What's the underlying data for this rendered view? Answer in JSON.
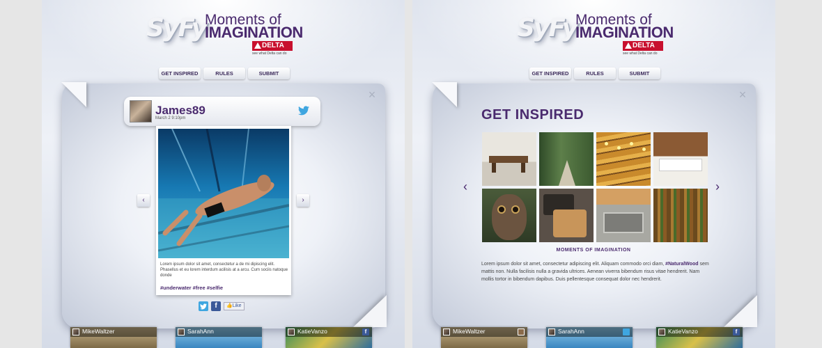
{
  "brand": {
    "logo": "SyFy",
    "title_line1": "Moments of",
    "title_line2": "IMAGINATION",
    "sponsor": "DELTA",
    "sponsor_tagline": "see what Delta can do"
  },
  "nav": [
    "GET INSPIRED",
    "RULES",
    "SUBMIT"
  ],
  "close_glyph": "×",
  "left_panel": {
    "user": "James89",
    "date": "March 2 9:10pm",
    "post_text": "Lorem ipsum dolor sit amet, consectetur a de mi dipiscing elit. Phasellus et eu lorem interdum acilisis at a arcu. Cum sociis natoque donde",
    "hashtags": "#underwater #free #selfie",
    "prev": "‹",
    "next": "›",
    "like_label": "Like",
    "fb_glyph": "f"
  },
  "thumbnails_left": [
    {
      "name": "MikeWaltzer",
      "network": "instagram"
    },
    {
      "name": "SarahAnn",
      "network": "instagram"
    },
    {
      "name": "KatieVanzo",
      "network": "facebook"
    }
  ],
  "right_panel": {
    "title": "GET INSPIRED",
    "caption": "MOMENTS OF IMAGINATION",
    "desc_before": "Lorem ipsum dolor sit amet, consectetur adipiscing elit. Aliquam commodo orci diam",
    "desc_hashtag": "#NaturalWood",
    "desc_after": " sem mattis non. Nulla facilisis nulla a gravida ultrices. Aenean viverra bibendum risus vitae hendrerit. Nam mollis tortor in bibendum dapibus. Duis pellentesque consequat dolor nec hendrerit.",
    "prev": "‹",
    "next": "›"
  },
  "thumbnails_right": [
    {
      "name": "MikeWaltzer",
      "network": "instagram"
    },
    {
      "name": "SarahAnn",
      "network": "twitter"
    },
    {
      "name": "KatieVanzo",
      "network": "facebook"
    }
  ],
  "colors": {
    "brand_purple": "#4a2a6e",
    "delta_red": "#c8102e",
    "twitter_blue": "#3fa6e0",
    "facebook_blue": "#3b5998"
  }
}
